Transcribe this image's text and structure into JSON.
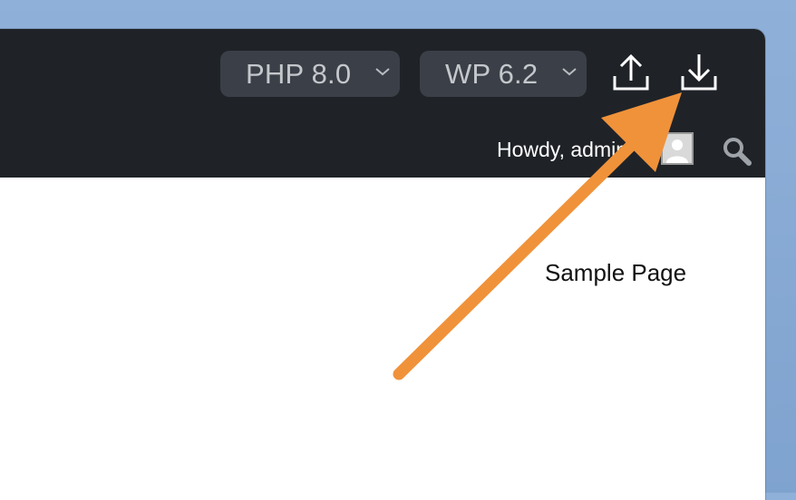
{
  "toolbar": {
    "php_select": {
      "value": "PHP 8.0",
      "icon": "chevron-down-icon"
    },
    "wp_select": {
      "value": "WP 6.2",
      "icon": "chevron-down-icon"
    },
    "upload_icon": "upload-icon",
    "download_icon": "download-icon"
  },
  "admin_bar": {
    "greeting": "Howdy, admin",
    "avatar_icon": "user-avatar-icon",
    "search_icon": "search-icon"
  },
  "content": {
    "menu_link": "Sample Page"
  },
  "annotation": {
    "type": "arrow",
    "points_to": "download-button",
    "color": "#f0923a"
  },
  "colors": {
    "toolbar_bg": "#1f2328",
    "select_bg": "#3b3f47",
    "page_bg": "#ffffff"
  }
}
